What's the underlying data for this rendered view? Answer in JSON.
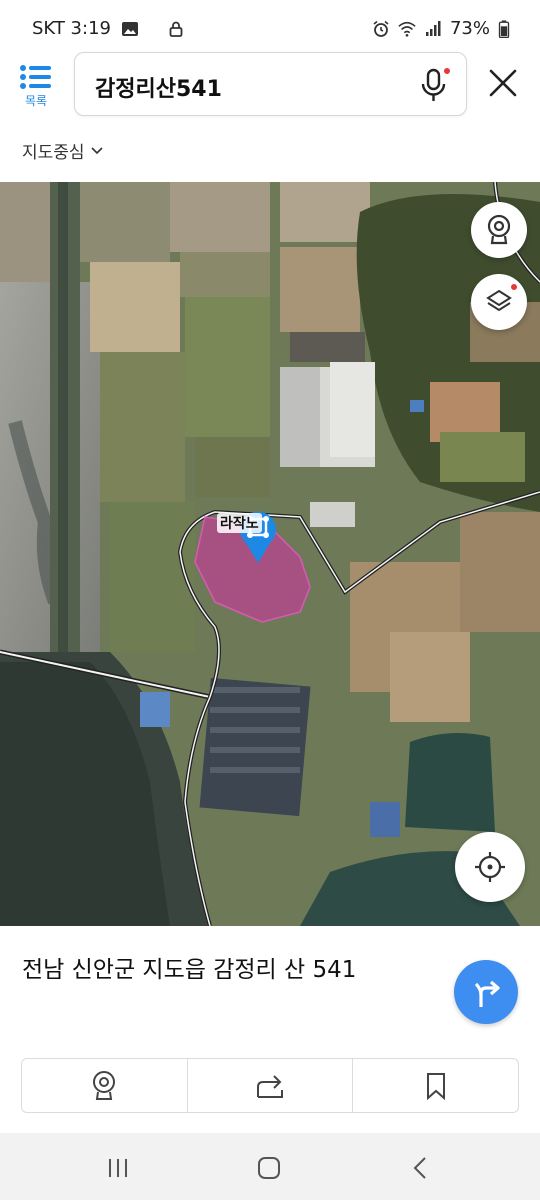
{
  "status_bar": {
    "carrier_time": "SKT 3:19",
    "battery": "73%",
    "icons": [
      "image-icon",
      "lock-icon",
      "alarm-icon",
      "wifi-icon",
      "signal-icon",
      "battery-icon"
    ]
  },
  "header": {
    "menu_label": "목록",
    "search_query": "감정리산541",
    "mic_has_badge": true
  },
  "map_center": {
    "label": "지도중심"
  },
  "map": {
    "pin_label": "라작노",
    "parcel_color": "#c43c9a",
    "pin_color": "#1e88e5",
    "layers_has_badge": true,
    "controls": [
      "streetview-icon",
      "layers-icon",
      "current-location-icon"
    ]
  },
  "place": {
    "address": "전남 신안군 지도읍 감정리 산 541"
  },
  "actions": [
    "streetview-icon",
    "share-icon",
    "bookmark-icon"
  ],
  "colors": {
    "accent": "#3d8ef0",
    "brand_blue": "#1e88e5",
    "badge_red": "#e53935"
  }
}
